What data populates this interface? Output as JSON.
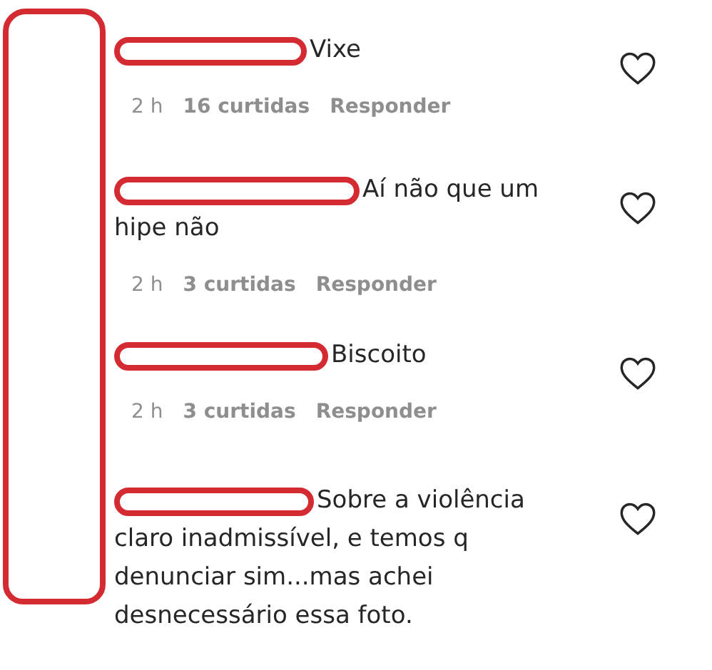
{
  "comments": [
    {
      "text": "Vixe",
      "time": "2 h",
      "likes": "16 curtidas",
      "reply": "Responder",
      "liked": false
    },
    {
      "text": "Aí não que um hipe não",
      "time": "2 h",
      "likes": "3 curtidas",
      "reply": "Responder",
      "liked": false
    },
    {
      "text": "Biscoito",
      "time": "2 h",
      "likes": "3 curtidas",
      "reply": "Responder",
      "liked": false
    },
    {
      "text": "Sobre a violência claro inadmissível, e temos q denunciar sim...mas achei desnecessário essa foto.",
      "liked": false
    }
  ]
}
